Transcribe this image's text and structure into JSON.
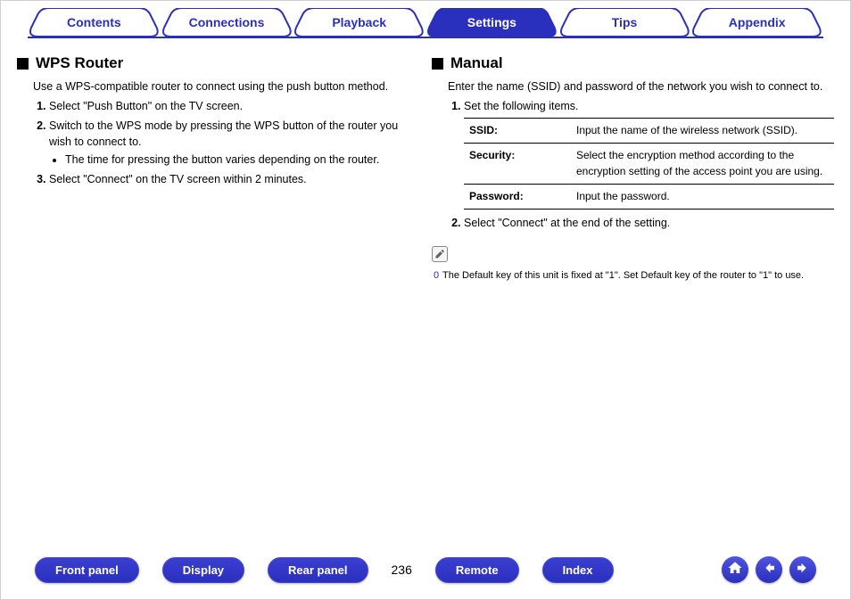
{
  "tabs": {
    "contents": "Contents",
    "connections": "Connections",
    "playback": "Playback",
    "settings": "Settings",
    "tips": "Tips",
    "appendix": "Appendix",
    "active": "settings"
  },
  "left": {
    "heading": "WPS Router",
    "intro": "Use a WPS-compatible router to connect using the push button method.",
    "step1": "Select \"Push Button\" on the TV screen.",
    "step2": "Switch to the WPS mode by pressing the WPS button of the router you wish to connect to.",
    "step2_bullet": "The time for pressing the button varies depending on the router.",
    "step3": "Select \"Connect\" on the TV screen within 2 minutes."
  },
  "right": {
    "heading": "Manual",
    "intro": "Enter the name (SSID) and password of the network you wish to connect to.",
    "step1": "Set the following items.",
    "table": {
      "ssid_k": "SSID:",
      "ssid_v": "Input the name of the wireless network (SSID).",
      "sec_k": "Security:",
      "sec_v": "Select the encryption method according to the encryption setting of the access point you are using.",
      "pass_k": "Password:",
      "pass_v": "Input the password."
    },
    "step2": "Select \"Connect\" at the end of the setting.",
    "note_bullet": "The Default key of this unit is fixed at \"1\". Set Default key of the router to \"1\" to use."
  },
  "bottom": {
    "front_panel": "Front panel",
    "display": "Display",
    "rear_panel": "Rear panel",
    "page": "236",
    "remote": "Remote",
    "index": "Index"
  }
}
